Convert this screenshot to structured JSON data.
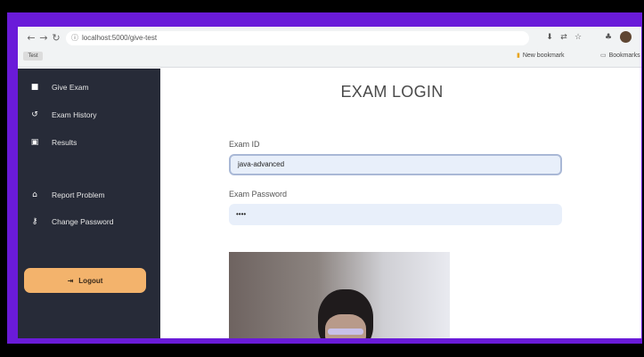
{
  "browser": {
    "url": "localhost:5000/give-test",
    "tab_chip": "Test",
    "bookmarks": [
      "New bookmark",
      "Bookmarks"
    ],
    "nav_icons": [
      "back-arrow-icon",
      "forward-arrow-icon",
      "reload-icon"
    ],
    "tool_icons": [
      "download-icon",
      "translate-icon",
      "star-icon",
      "extension-icon"
    ]
  },
  "sidebar": {
    "items": [
      {
        "label": "Give Exam",
        "icon": "book-icon"
      },
      {
        "label": "Exam History",
        "icon": "history-icon"
      },
      {
        "label": "Results",
        "icon": "results-icon"
      },
      {
        "label": "Report Problem",
        "icon": "home-icon"
      },
      {
        "label": "Change Password",
        "icon": "key-icon"
      }
    ],
    "logout_label": "Logout"
  },
  "main": {
    "title": "EXAM LOGIN",
    "exam_id_label": "Exam ID",
    "exam_id_value": "java-advanced",
    "exam_password_label": "Exam Password",
    "exam_password_value": "••••"
  },
  "colors": {
    "frame": "#6a1bd9",
    "sidebar": "#272b38",
    "logout": "#f3b36c",
    "input_bg": "#e8effa"
  }
}
